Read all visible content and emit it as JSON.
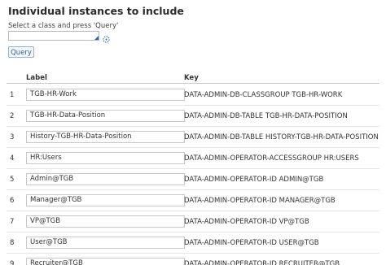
{
  "section": {
    "title": "Individual instances to include",
    "hint": "Select a class and press 'Query'"
  },
  "class_input": {
    "value": ""
  },
  "icons": {
    "picker": "target-picker-icon",
    "dropdown": "autocomplete-corner-icon"
  },
  "query_button": {
    "label": "Query"
  },
  "table": {
    "columns": {
      "label": "Label",
      "key": "Key"
    },
    "rows": [
      {
        "index": "1",
        "label": "TGB-HR-Work",
        "key": "DATA-ADMIN-DB-CLASSGROUP TGB-HR-WORK"
      },
      {
        "index": "2",
        "label": "TGB-HR-Data-Position",
        "key": "DATA-ADMIN-DB-TABLE TGB-HR-DATA-POSITION"
      },
      {
        "index": "3",
        "label": "History-TGB-HR-Data-Position",
        "key": "DATA-ADMIN-DB-TABLE HISTORY-TGB-HR-DATA-POSITION"
      },
      {
        "index": "4",
        "label": "HR:Users",
        "key": "DATA-ADMIN-OPERATOR-ACCESSGROUP HR:USERS"
      },
      {
        "index": "5",
        "label": "Admin@TGB",
        "key": "DATA-ADMIN-OPERATOR-ID ADMIN@TGB"
      },
      {
        "index": "6",
        "label": "Manager@TGB",
        "key": "DATA-ADMIN-OPERATOR-ID MANAGER@TGB"
      },
      {
        "index": "7",
        "label": "VP@TGB",
        "key": "DATA-ADMIN-OPERATOR-ID VP@TGB"
      },
      {
        "index": "8",
        "label": "User@TGB",
        "key": "DATA-ADMIN-OPERATOR-ID USER@TGB"
      },
      {
        "index": "9",
        "label": "Recruiter@TGB",
        "key": "DATA-ADMIN-OPERATOR-ID RECRUITER@TGB"
      }
    ]
  },
  "colors": {
    "accent": "#2f63b5",
    "border": "#c8c8c8",
    "text": "#333333"
  }
}
